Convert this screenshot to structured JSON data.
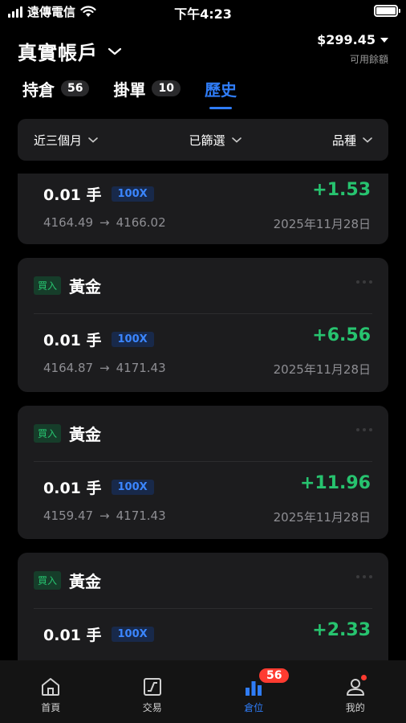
{
  "status_bar": {
    "carrier": "遠傳電信",
    "time": "下午4:23"
  },
  "account": {
    "name": "真實帳戶",
    "balance": "$299.45",
    "balance_caption": "可用餘額"
  },
  "tabs": [
    {
      "label": "持倉",
      "count": "56"
    },
    {
      "label": "掛單",
      "count": "10"
    },
    {
      "label": "歷史",
      "count": ""
    }
  ],
  "filters": {
    "period": "近三個月",
    "filtered": "已篩選",
    "product": "品種"
  },
  "trades": [
    {
      "side": "",
      "symbol": "",
      "qty": "0.01 手",
      "leverage": "100X",
      "pnl": "+1.53",
      "open": "4164.49",
      "arrow": "→",
      "close": "4166.02",
      "date": "2025年11月28日"
    },
    {
      "side": "買入",
      "symbol": "黃金",
      "qty": "0.01 手",
      "leverage": "100X",
      "pnl": "+6.56",
      "open": "4164.87",
      "arrow": "→",
      "close": "4171.43",
      "date": "2025年11月28日"
    },
    {
      "side": "買入",
      "symbol": "黃金",
      "qty": "0.01 手",
      "leverage": "100X",
      "pnl": "+11.96",
      "open": "4159.47",
      "arrow": "→",
      "close": "4171.43",
      "date": "2025年11月28日"
    },
    {
      "side": "買入",
      "symbol": "黃金",
      "qty": "0.01 手",
      "leverage": "100X",
      "pnl": "+2.33",
      "open": "",
      "arrow": "",
      "close": "",
      "date": ""
    }
  ],
  "nav": {
    "home": "首頁",
    "trade": "交易",
    "positions": "倉位",
    "positions_badge": "56",
    "me": "我的"
  },
  "colors": {
    "accent": "#2f7cf6",
    "profit": "#27c36f",
    "badge": "#ff3b30"
  }
}
